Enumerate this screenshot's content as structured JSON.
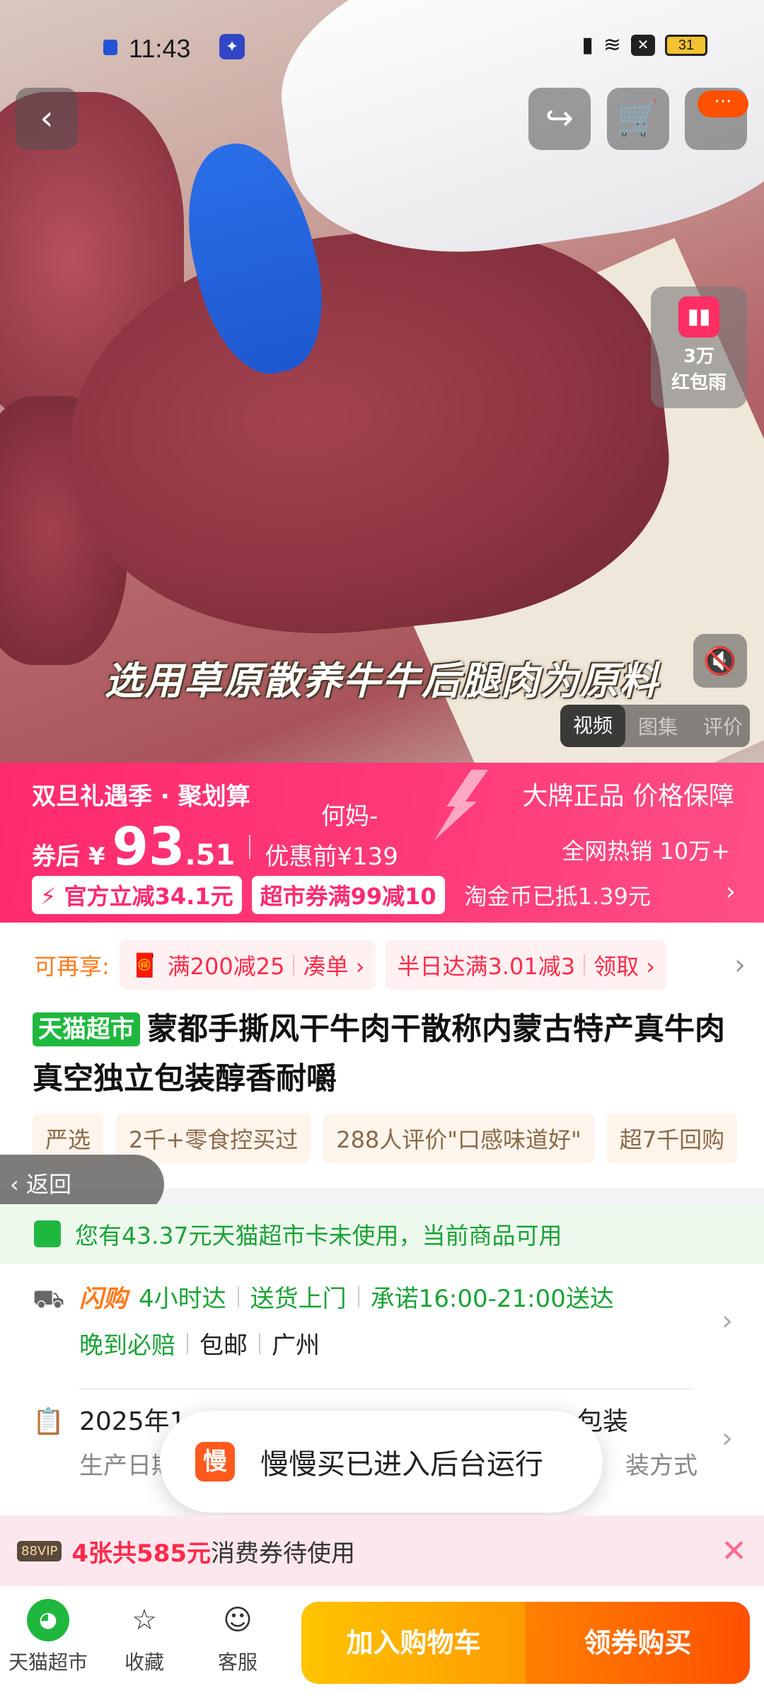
{
  "status_bar": {
    "time": "11:43",
    "battery": "31"
  },
  "hero": {
    "caption": "选用草原散养牛牛后腿肉为原料",
    "red_packet": {
      "count": "3万",
      "label": "红包雨"
    },
    "media_tabs": [
      "视频",
      "图集",
      "评价"
    ],
    "more_badge": "···"
  },
  "promo": {
    "event": "双旦礼遇季 · 聚划算",
    "watermark": "何妈-",
    "guarantee": "大牌正品 价格保障",
    "price_label": "券后 ¥",
    "price_int": "93",
    "price_dec": ".51",
    "original_price": "优惠前¥139",
    "hot_sales": "全网热销 10万+",
    "chip1": "官方立减34.1元",
    "chip2": "超市券满99减10",
    "coin_text": "淘金币已抵1.39元"
  },
  "coupons": {
    "label": "可再享:",
    "c1_main": "满200减25",
    "c1_action": "凑单 ›",
    "c2_main": "半日达满3.01减3",
    "c2_action": "领取 ›"
  },
  "product": {
    "store_tag": "天猫超市",
    "title": "蒙都手撕风干牛肉干散称内蒙古特产真牛肉真空独立包装醇香耐嚼",
    "tags": [
      "严选",
      "2千+零食控买过",
      "288人评价\"口感味道好\"",
      "超7千回购"
    ]
  },
  "back_pill": "返回",
  "card_notice": "您有43.37元天猫超市卡未使用，当前商品可用",
  "shipping": {
    "flash": "闪购",
    "eta": "4小时达",
    "door": "送货上门",
    "promise": "承诺16:00-21:00送达",
    "late": "晚到必赔",
    "free": "包邮",
    "city": "广州"
  },
  "product_info": {
    "line1_left": "2025年1",
    "line1_right": "包装",
    "line2_left": "生产日期",
    "line2_right": "装方式"
  },
  "toast": {
    "app_glyph": "慢",
    "text": "慢慢买已进入后台运行"
  },
  "voucher": {
    "badge": "88VIP",
    "highlight": "4张共585元",
    "rest": "消费券待使用"
  },
  "bottom_bar": {
    "tab1": "天猫超市",
    "tab2": "收藏",
    "tab3": "客服",
    "add_cart": "加入购物车",
    "buy": "领券购买"
  },
  "colors": {
    "brand_pink": "#ff2a6d",
    "orange": "#ff5000",
    "tmall_green": "#1fb83f"
  }
}
